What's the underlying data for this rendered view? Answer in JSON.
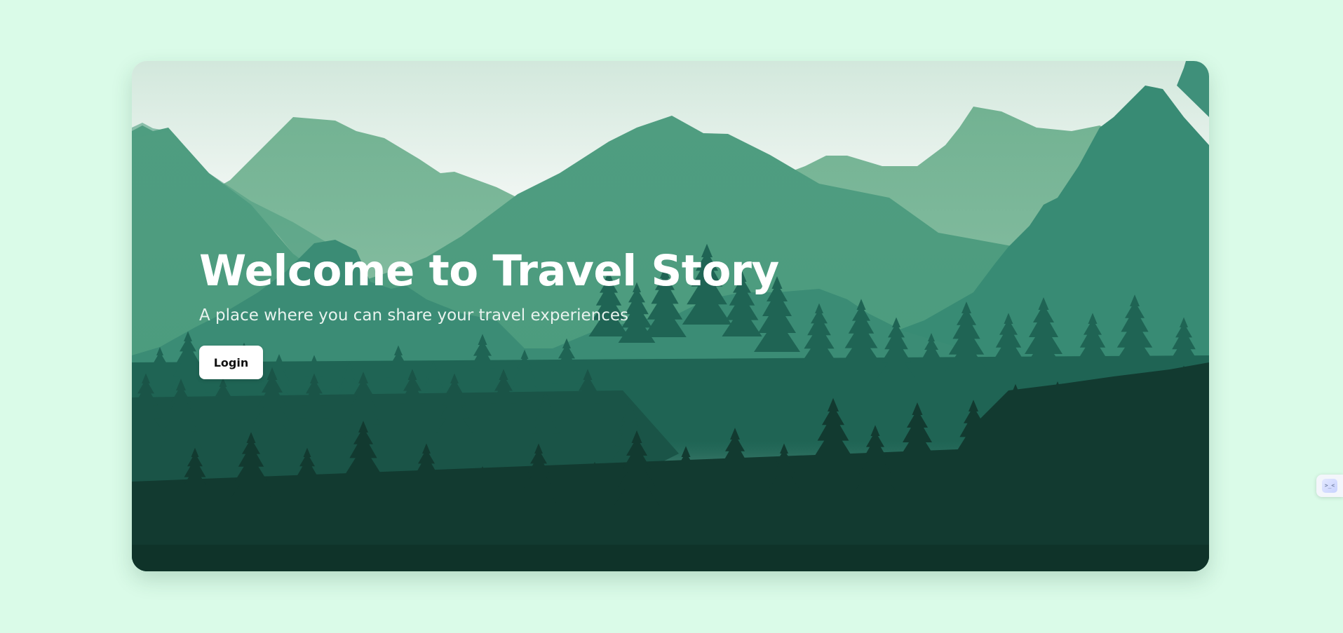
{
  "hero": {
    "title": "Welcome to Travel Story",
    "subtitle": "A place where you can share your travel experiences",
    "login_label": "Login"
  },
  "background": {
    "scene": "forest-mountains",
    "colors": {
      "sky_top": "#d2e8dc",
      "sky_bottom": "#eef5f1",
      "far_mountains": "#7fb99b",
      "mid_mountains": "#53a083",
      "near_mountains": "#358a74",
      "forest_back": "#1f6454",
      "forest_front": "#13392f"
    }
  },
  "widget": {
    "icon": "assistant-face-icon",
    "glyph": ">_<"
  },
  "theme": {
    "page_bg": "#dafbe8",
    "button_bg": "#ffffff",
    "title_color": "#ffffff"
  }
}
